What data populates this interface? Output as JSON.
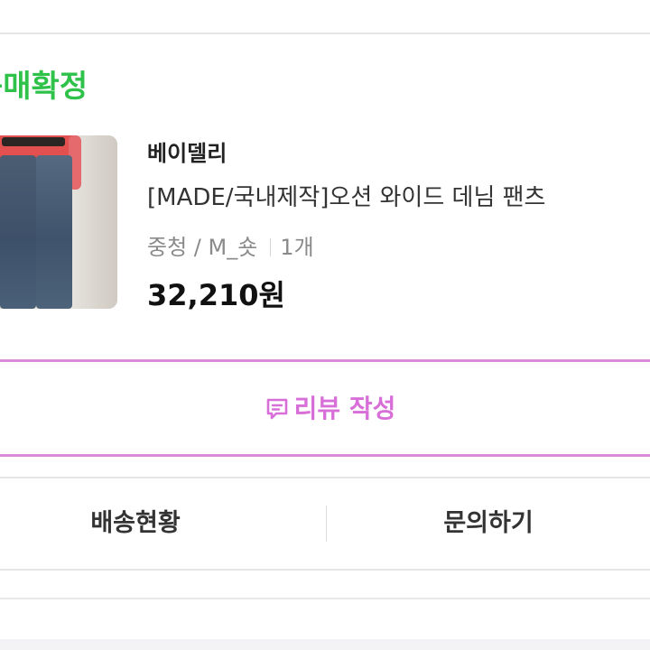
{
  "order": {
    "status": "구매확정",
    "item": {
      "brand": "베이델리",
      "name": "[MADE/국내제작]오션 와이드 데님 팬츠",
      "option": "중청 / M_숏",
      "quantity": "1개",
      "price": "32,210원",
      "thumbnail_icon": "product-photo"
    },
    "review_button": {
      "label": "리뷰 작성",
      "icon": "review-speech-icon",
      "color": "#d86fd8"
    },
    "actions": {
      "shipping": "배송현황",
      "inquiry": "문의하기"
    }
  },
  "colors": {
    "status": "#2fc24a",
    "review_border": "#d98ad9"
  }
}
